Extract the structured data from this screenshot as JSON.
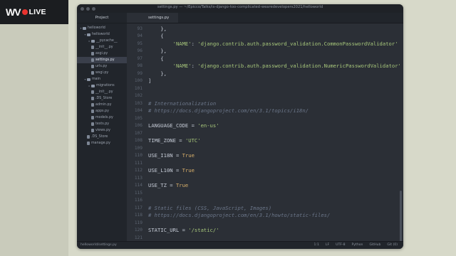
{
  "stream": {
    "brand": "WV",
    "live": "LIVE"
  },
  "window": {
    "title": "settings.py — ~/Epicco/Talks/is-django-too-complicated-wearedevelopers2021/helloworld"
  },
  "sidebar": {
    "header": "Project",
    "items": [
      {
        "label": "helloworld",
        "type": "folder",
        "indent": 0,
        "open": true
      },
      {
        "label": "helloworld",
        "type": "folder",
        "indent": 1,
        "open": true
      },
      {
        "label": "__pycache__",
        "type": "folder",
        "indent": 2,
        "open": false
      },
      {
        "label": "__init__.py",
        "type": "file",
        "indent": 2
      },
      {
        "label": "asgi.py",
        "type": "file",
        "indent": 2
      },
      {
        "label": "settings.py",
        "type": "file",
        "indent": 2,
        "selected": true
      },
      {
        "label": "urls.py",
        "type": "file",
        "indent": 2
      },
      {
        "label": "wsgi.py",
        "type": "file",
        "indent": 2
      },
      {
        "label": "main",
        "type": "folder",
        "indent": 1,
        "open": true
      },
      {
        "label": "migrations",
        "type": "folder",
        "indent": 2,
        "open": false
      },
      {
        "label": "__init__.py",
        "type": "file",
        "indent": 2
      },
      {
        "label": ".DS_Store",
        "type": "file",
        "indent": 2
      },
      {
        "label": "admin.py",
        "type": "file",
        "indent": 2
      },
      {
        "label": "apps.py",
        "type": "file",
        "indent": 2
      },
      {
        "label": "models.py",
        "type": "file",
        "indent": 2
      },
      {
        "label": "tests.py",
        "type": "file",
        "indent": 2
      },
      {
        "label": "views.py",
        "type": "file",
        "indent": 2
      },
      {
        "label": ".DS_Store",
        "type": "file",
        "indent": 1
      },
      {
        "label": "manage.py",
        "type": "file",
        "indent": 1
      }
    ]
  },
  "tabs": [
    {
      "label": "settings.py",
      "active": true
    }
  ],
  "editor": {
    "lines": [
      {
        "n": "93",
        "tokens": [
          {
            "t": "    },"
          }
        ]
      },
      {
        "n": "94",
        "tokens": [
          {
            "t": "    {"
          }
        ]
      },
      {
        "n": "95",
        "tokens": [
          {
            "t": "        "
          },
          {
            "t": "'NAME'",
            "c": "str"
          },
          {
            "t": ": "
          },
          {
            "t": "'django.contrib.auth.password_validation.CommonPasswordValidator'",
            "c": "str"
          }
        ]
      },
      {
        "n": "96",
        "tokens": [
          {
            "t": "    },"
          }
        ]
      },
      {
        "n": "97",
        "tokens": [
          {
            "t": "    {"
          }
        ]
      },
      {
        "n": "98",
        "tokens": [
          {
            "t": "        "
          },
          {
            "t": "'NAME'",
            "c": "str"
          },
          {
            "t": ": "
          },
          {
            "t": "'django.contrib.auth.password_validation.NumericPasswordValidator'",
            "c": "str"
          }
        ]
      },
      {
        "n": "99",
        "tokens": [
          {
            "t": "    },"
          }
        ]
      },
      {
        "n": "100",
        "tokens": [
          {
            "t": "]"
          }
        ]
      },
      {
        "n": "101",
        "tokens": [
          {
            "t": ""
          }
        ]
      },
      {
        "n": "102",
        "tokens": [
          {
            "t": ""
          }
        ]
      },
      {
        "n": "103",
        "tokens": [
          {
            "t": "# Internationalization",
            "c": "cm"
          }
        ]
      },
      {
        "n": "104",
        "tokens": [
          {
            "t": "# https://docs.djangoproject.com/en/3.1/topics/i18n/",
            "c": "cm"
          }
        ]
      },
      {
        "n": "105",
        "tokens": [
          {
            "t": ""
          }
        ]
      },
      {
        "n": "106",
        "tokens": [
          {
            "t": "LANGUAGE_CODE = "
          },
          {
            "t": "'en-us'",
            "c": "str"
          }
        ]
      },
      {
        "n": "107",
        "tokens": [
          {
            "t": ""
          }
        ]
      },
      {
        "n": "108",
        "tokens": [
          {
            "t": "TIME_ZONE = "
          },
          {
            "t": "'UTC'",
            "c": "str"
          }
        ]
      },
      {
        "n": "109",
        "tokens": [
          {
            "t": ""
          }
        ]
      },
      {
        "n": "110",
        "tokens": [
          {
            "t": "USE_I18N = "
          },
          {
            "t": "True",
            "c": "kw"
          }
        ]
      },
      {
        "n": "111",
        "tokens": [
          {
            "t": ""
          }
        ]
      },
      {
        "n": "112",
        "tokens": [
          {
            "t": "USE_L10N = "
          },
          {
            "t": "True",
            "c": "kw"
          }
        ]
      },
      {
        "n": "113",
        "tokens": [
          {
            "t": ""
          }
        ]
      },
      {
        "n": "114",
        "tokens": [
          {
            "t": "USE_TZ = "
          },
          {
            "t": "True",
            "c": "kw"
          }
        ]
      },
      {
        "n": "115",
        "tokens": [
          {
            "t": ""
          }
        ]
      },
      {
        "n": "116",
        "tokens": [
          {
            "t": ""
          }
        ]
      },
      {
        "n": "117",
        "tokens": [
          {
            "t": "# Static files (CSS, JavaScript, Images)",
            "c": "cm"
          }
        ]
      },
      {
        "n": "118",
        "tokens": [
          {
            "t": "# https://docs.djangoproject.com/en/3.1/howto/static-files/",
            "c": "cm"
          }
        ]
      },
      {
        "n": "119",
        "tokens": [
          {
            "t": ""
          }
        ]
      },
      {
        "n": "120",
        "tokens": [
          {
            "t": "STATIC_URL = "
          },
          {
            "t": "'/static/'",
            "c": "str"
          }
        ]
      },
      {
        "n": "121",
        "tokens": [
          {
            "t": ""
          }
        ]
      }
    ]
  },
  "status": {
    "path": "helloworld/settings.py",
    "position": "1:1",
    "line_ending": "LF",
    "encoding": "UTF-8",
    "language": "Python",
    "git": "GitHub",
    "git_status": "Git (0)"
  }
}
